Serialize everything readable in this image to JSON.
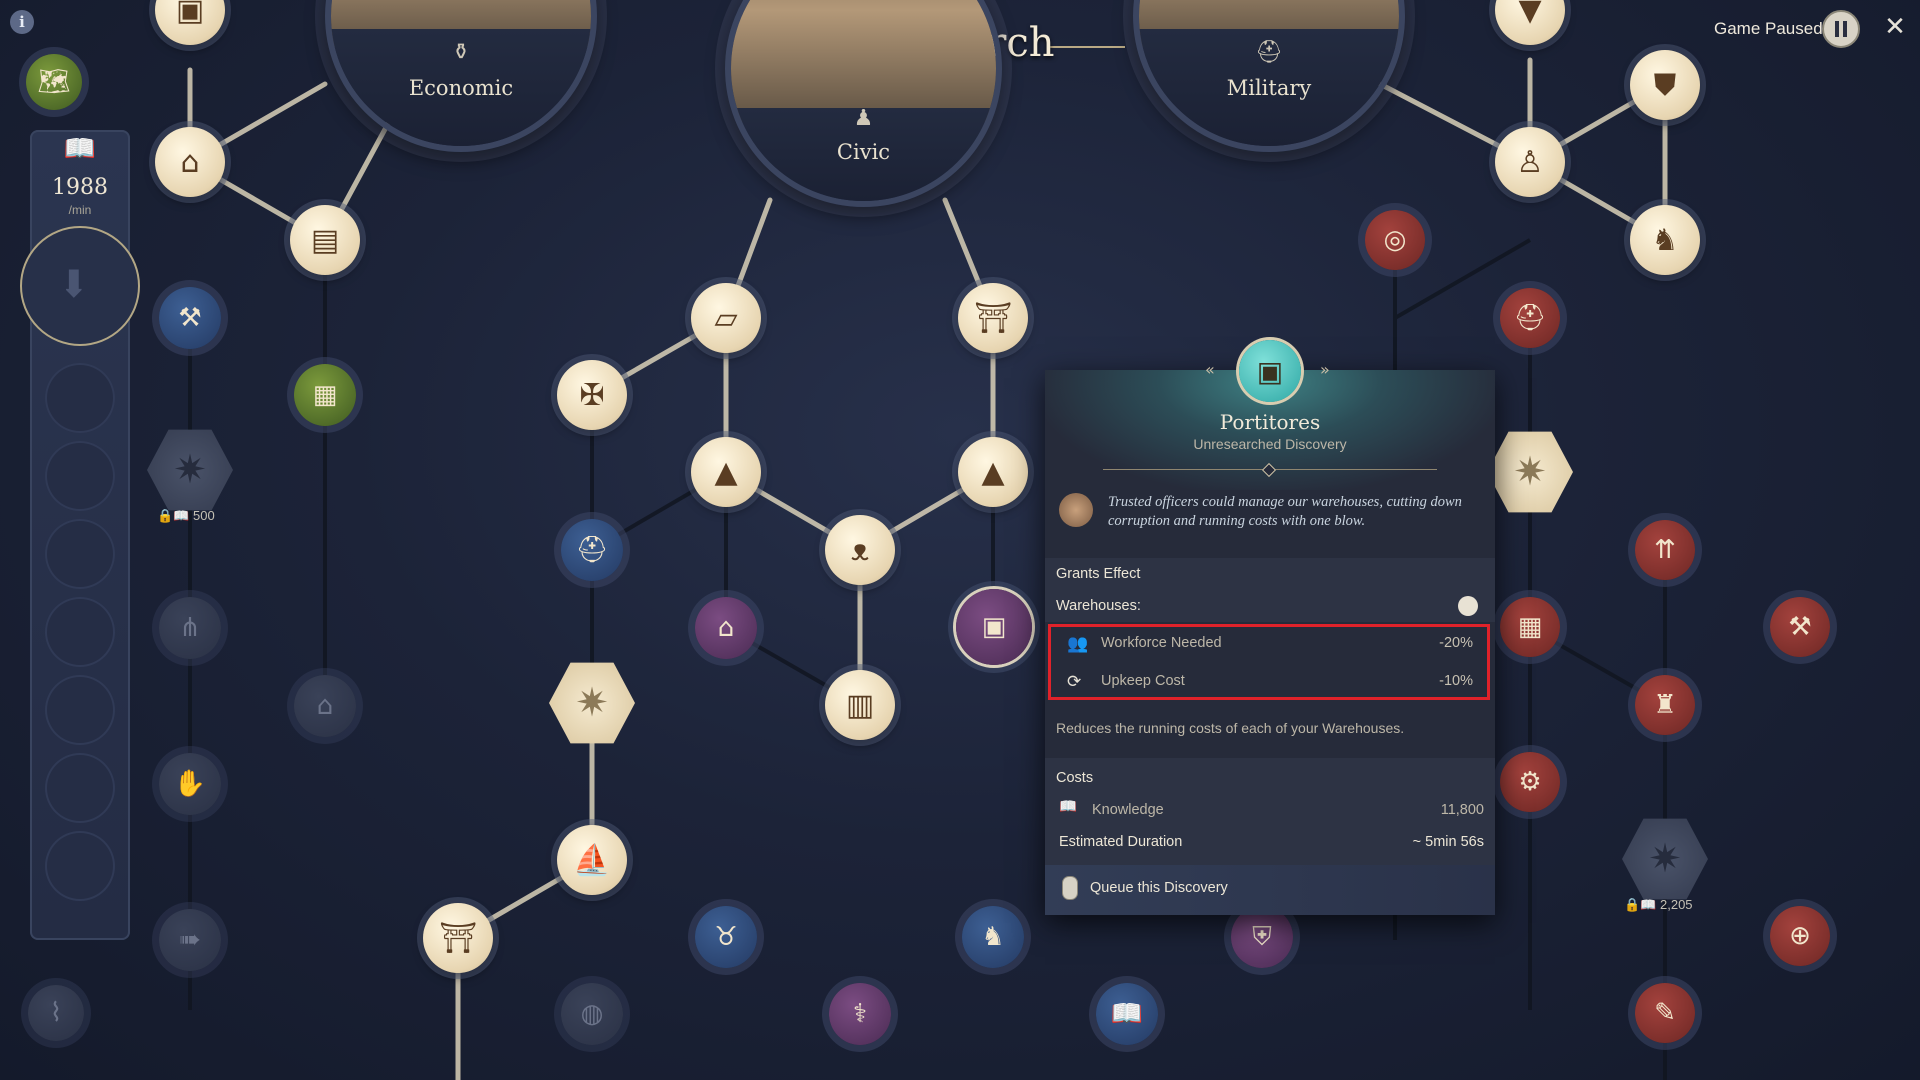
{
  "header": {
    "title": "Research",
    "branches": [
      {
        "label": "Economic",
        "icon": "amphora-icon"
      },
      {
        "label": "Civic",
        "icon": "citizen-icon"
      },
      {
        "label": "Military",
        "icon": "helmet-icon"
      }
    ]
  },
  "topbar": {
    "paused_label": "Game Paused",
    "pause_icon": "pause-icon",
    "close_icon": "close-icon",
    "info_icon": "info-icon"
  },
  "knowledge": {
    "rate": "1988",
    "unit": "/min"
  },
  "locked_costs": {
    "left": "500",
    "right": "2,205"
  },
  "tooltip": {
    "name": "Portitores",
    "status": "Unresearched Discovery",
    "description": "Trusted officers could manage our warehouses, cutting down corruption and running costs with one blow.",
    "grants_heading": "Grants Effect",
    "target": "Warehouses:",
    "effects": [
      {
        "label": "Workforce Needed",
        "value": "-20%",
        "icon": "workforce-icon"
      },
      {
        "label": "Upkeep Cost",
        "value": "-10%",
        "icon": "upkeep-icon"
      }
    ],
    "summary": "Reduces the running costs of each of your Warehouses.",
    "costs_heading": "Costs",
    "cost_label": "Knowledge",
    "cost_value": "11,800",
    "duration_label": "Estimated Duration",
    "duration_value": "~ 5min 56s",
    "queue_label": "Queue this Discovery"
  },
  "colors": {
    "highlight": "#e0222a",
    "tooltip_teal": "#3e8083",
    "node_cream": "#e7d5b1",
    "node_red": "#6d2724",
    "node_purple": "#4a2b53"
  }
}
